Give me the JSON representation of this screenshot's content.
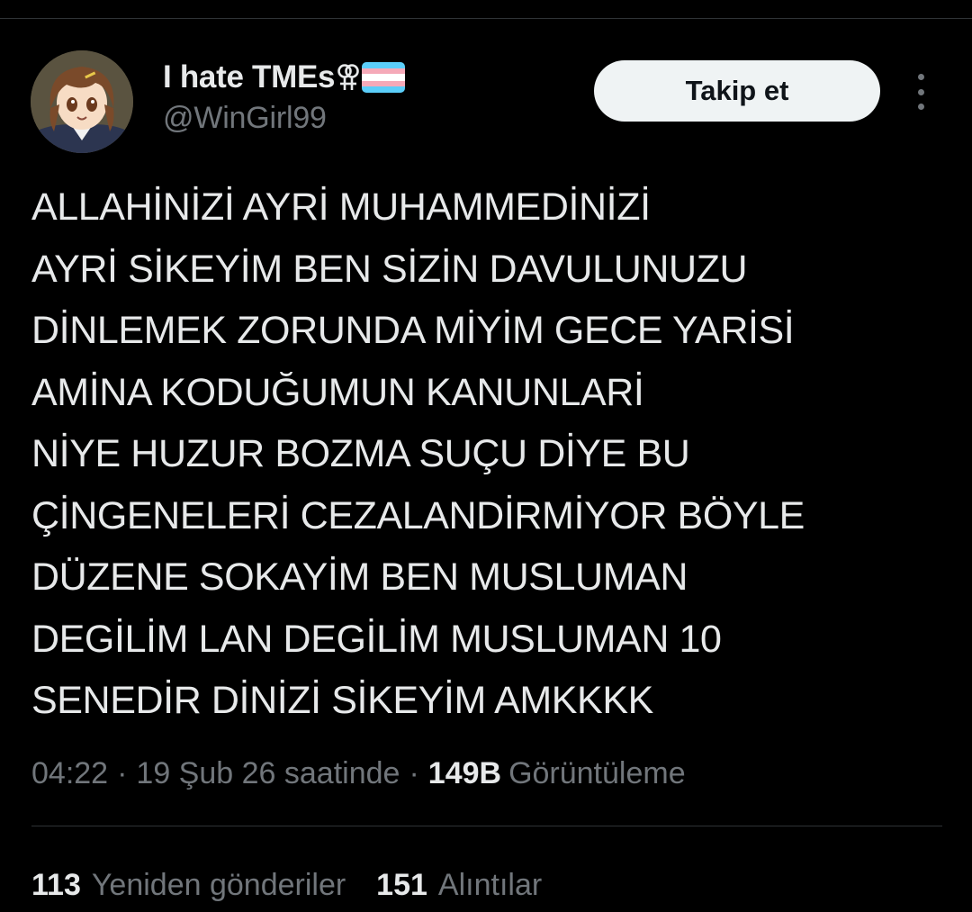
{
  "tweet": {
    "author": {
      "display_name": "I hate TMEs",
      "handle": "@WinGirl99",
      "name_emoji": [
        "double-venus-icon",
        "transgender-flag-icon"
      ]
    },
    "follow_button_label": "Takip et",
    "more_icon": "more-options-icon",
    "text_lines": [
      "ALLAHİNİZİ AYRİ MUHAMMEDİNİZİ",
      "AYRİ SİKEYİM BEN SİZİN DAVULUNUZU",
      "DİNLEMEK ZORUNDA MİYİM GECE YARİSİ",
      "AMİNA KODUĞUMUN KANUNLARİ",
      "NİYE HUZUR BOZMA SUÇU DİYE BU",
      "ÇİNGENELERİ CEZALANDİRMİYOR BÖYLE",
      "DÜZENE SOKAYİM BEN MUSLUMAN",
      "DEGİLİM LAN DEGİLİM MUSLUMAN 10",
      "SENEDİR DİNİZİ SİKEYİM AMKKKK"
    ],
    "meta": {
      "time_text": "04:22",
      "separator": "·",
      "date_text": "19 Şub 26 saatinde",
      "views_count": "149B",
      "views_label": "Görüntüleme"
    },
    "stats": [
      {
        "count": "113",
        "label": "Yeniden gönderiler"
      },
      {
        "count": "151",
        "label": "Alıntılar"
      }
    ]
  },
  "colors": {
    "background": "#000000",
    "text_primary": "#e7e9ea",
    "text_secondary": "#71767b",
    "divider": "#2f3336",
    "follow_button_bg": "#eff3f4",
    "follow_button_text": "#0f1419",
    "trans_blue": "#5bcefa",
    "trans_pink": "#f5a9b8",
    "trans_white": "#ffffff"
  }
}
